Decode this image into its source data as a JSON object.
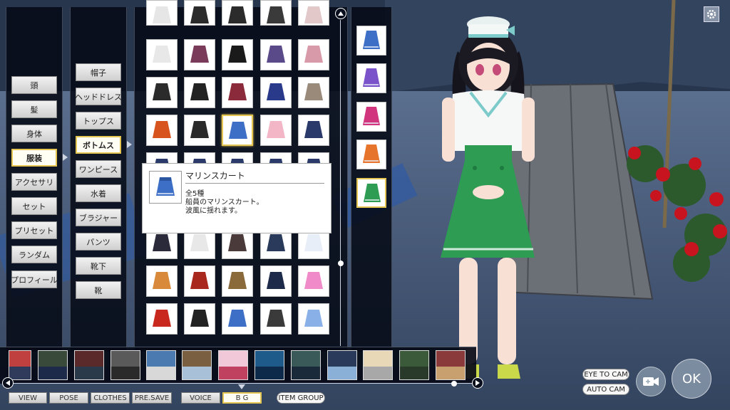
{
  "colors": {
    "selected_border": "#e6c653",
    "panel_bg": "#0a0f1e",
    "skirt_green": "#2e9c53",
    "skirt_blue": "#3d6fc6"
  },
  "categories": [
    {
      "label": "頭",
      "selected": false
    },
    {
      "label": "髪",
      "selected": false
    },
    {
      "label": "身体",
      "selected": false
    },
    {
      "label": "服装",
      "selected": true
    },
    {
      "label": "アクセサリ",
      "selected": false
    },
    {
      "label": "セット",
      "selected": false
    },
    {
      "label": "プリセット",
      "selected": false
    },
    {
      "label": "ランダム",
      "selected": false
    },
    {
      "label": "プロフィール",
      "selected": false
    }
  ],
  "subcategories": [
    {
      "label": "帽子",
      "selected": false
    },
    {
      "label": "ヘッドドレス",
      "selected": false
    },
    {
      "label": "トップス",
      "selected": false
    },
    {
      "label": "ボトムス",
      "selected": true
    },
    {
      "label": "ワンピース",
      "selected": false
    },
    {
      "label": "水着",
      "selected": false
    },
    {
      "label": "ブラジャー",
      "selected": false
    },
    {
      "label": "パンツ",
      "selected": false
    },
    {
      "label": "靴下",
      "selected": false
    },
    {
      "label": "靴",
      "selected": false
    }
  ],
  "tooltip": {
    "title": "マリンスカート",
    "count": "全5種",
    "desc_line1": "船員のマリンスカート。",
    "desc_line2": "波風に揺れます。"
  },
  "color_variants": [
    {
      "color": "#3d6fc6",
      "selected": false
    },
    {
      "color": "#7a52c9",
      "selected": false
    },
    {
      "color": "#d0357e",
      "selected": false
    },
    {
      "color": "#e6742a",
      "selected": false
    },
    {
      "color": "#2e9c53",
      "selected": true
    }
  ],
  "bottom_buttons": {
    "view": "VIEW",
    "pose": "POSE",
    "clothes": "CLOTHES",
    "presave": "PRE.SAVE",
    "voice": "VOICE",
    "bg": "B G",
    "item_group": "ITEM GROUP"
  },
  "camera_buttons": {
    "eye_to_cam": "EYE TO CAM",
    "auto_cam": "AUTO CAM",
    "ok": "OK"
  },
  "icons": {
    "settings": "gear-icon",
    "video": "video-camera-icon",
    "scroll_up": "chevron-up-icon",
    "scroll_left": "chevron-left-icon",
    "scroll_right": "chevron-right-icon"
  }
}
